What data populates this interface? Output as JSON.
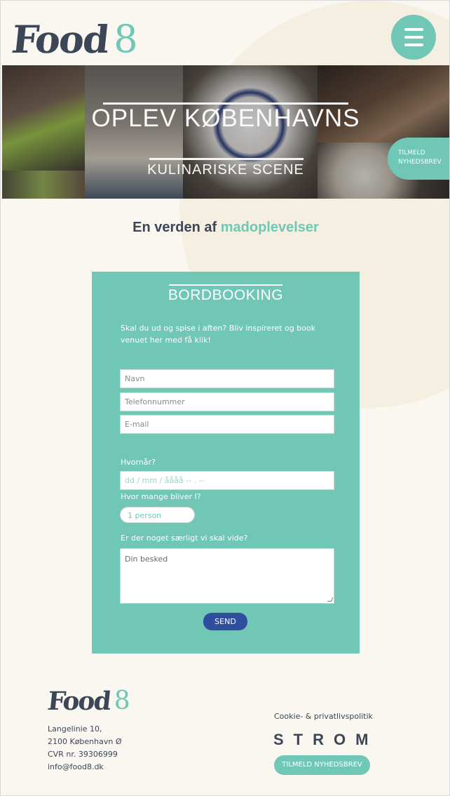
{
  "brand": {
    "logo_word": "Food",
    "logo_number": "8",
    "accent_color": "#70c7b5",
    "dark_color": "#3c4656",
    "button_color": "#2f4f9e"
  },
  "header": {
    "menu_icon": "hamburger-menu-icon"
  },
  "hero": {
    "title": "OPLEV KØBENHAVNS",
    "subtitle": "KULINARISKE SCENE",
    "newsletter_tab_line1": "TILMELD",
    "newsletter_tab_line2": "NYHEDSBREV"
  },
  "tagline": {
    "lead": "En verden af",
    "accent": "madoplevelser"
  },
  "booking": {
    "title": "BORDBOOKING",
    "intro": "Skal du ud og spise i aften? Bliv inspireret og book venuet her med få klik!",
    "name_placeholder": "Navn",
    "phone_placeholder": "Telefonnummer",
    "email_placeholder": "E-mail",
    "when_label": "Hvornår?",
    "date_placeholder": "dd / mm / åååå  -- . --",
    "guests_label": "Hvor mange bliver I?",
    "guests_value": "1 person",
    "notes_label": "Er der noget særligt vi skal vide?",
    "message_placeholder": "Din besked",
    "send_label": "SEND"
  },
  "footer": {
    "address_line1": "Langelinie 10,",
    "address_line2": "2100 København Ø",
    "cvr": "CVR nr. 39306999",
    "email": "info@food8.dk",
    "cookie_link": "Cookie- & privatlivspolitik",
    "partner_logo": "STROM",
    "newsletter_button": "TILMELD NYHEDSBREV"
  }
}
